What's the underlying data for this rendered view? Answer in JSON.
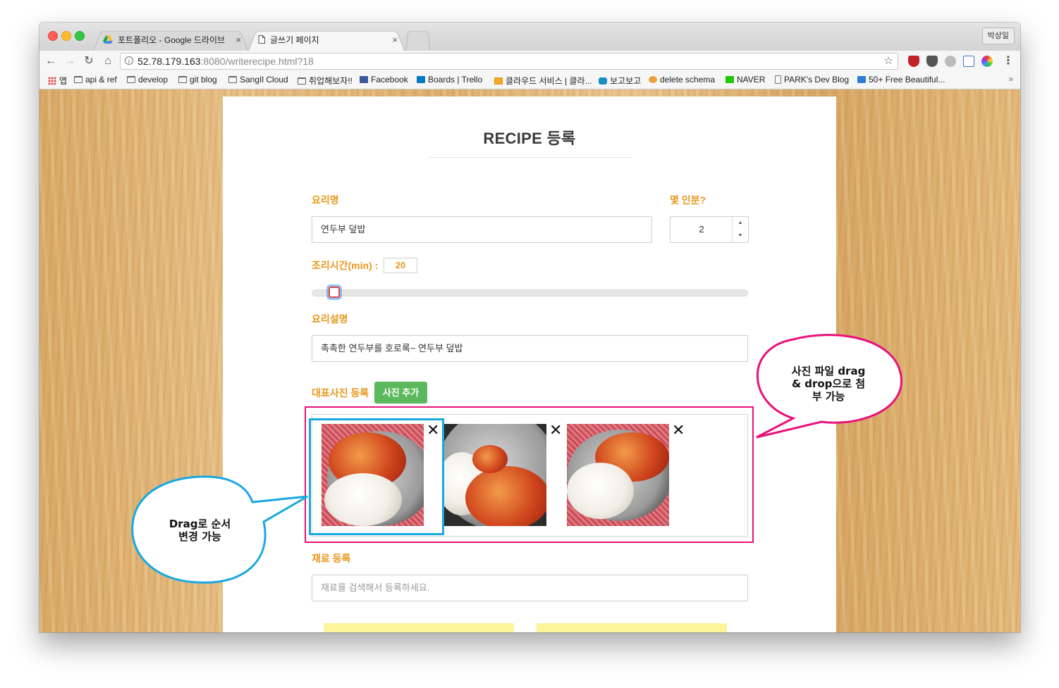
{
  "browser": {
    "tabs": [
      {
        "title": "포트폴리오 - Google 드라이브",
        "close": "×",
        "active": false
      },
      {
        "title": "글쓰기 페이지",
        "close": "×",
        "active": true
      }
    ],
    "profile_name": "박상일",
    "url_host": "52.78.179.163",
    "url_rest": ":8080/writerecipe.html?18",
    "bookmarks": [
      {
        "label": "앱",
        "icon": "apps-icon"
      },
      {
        "label": "api & ref",
        "icon": "folder-icon"
      },
      {
        "label": "develop",
        "icon": "folder-icon"
      },
      {
        "label": "git blog",
        "icon": "folder-icon"
      },
      {
        "label": "SangIl Cloud",
        "icon": "folder-icon"
      },
      {
        "label": "취업해보자!!",
        "icon": "folder-icon"
      },
      {
        "label": "Facebook",
        "icon": "facebook-icon"
      },
      {
        "label": "Boards | Trello",
        "icon": "trello-icon"
      },
      {
        "label": "클라우드 서비스 | 클라...",
        "icon": "cloud-icon"
      },
      {
        "label": "보고보고",
        "icon": "bogo-icon"
      },
      {
        "label": "delete schema",
        "icon": "schema-icon"
      },
      {
        "label": "NAVER",
        "icon": "naver-icon"
      },
      {
        "label": "PARK's Dev Blog",
        "icon": "page-icon"
      },
      {
        "label": "50+ Free Beautiful...",
        "icon": "free-icon"
      }
    ],
    "more": "»"
  },
  "form": {
    "title": "RECIPE 등록",
    "dish_name_label": "요리명",
    "dish_name_value": "연두부 덮밥",
    "servings_label": "몇 인분?",
    "servings_value": "2",
    "cook_time_label": "조리시간(min) :",
    "cook_time_value": "20",
    "cook_time_slider_fraction": 0.04,
    "description_label": "요리설명",
    "description_value": "촉촉한 연두부를 호로록~ 연두부 덮밥",
    "photo_label": "대표사진 등록",
    "photo_add_button": "사진 추가",
    "photos": [
      {
        "remove": "✕",
        "variant": "rice-with-sauce"
      },
      {
        "remove": "✕",
        "variant": "spoon-closeup"
      },
      {
        "remove": "✕",
        "variant": "rice-with-sauce"
      }
    ],
    "ingredient_label": "재료 등록",
    "ingredient_placeholder": "재료를 검색해서 등록하세요."
  },
  "callouts": {
    "drop": [
      "사진 파일 drag",
      "& drop으로 첨",
      "부 가능"
    ],
    "drag": [
      "Drag로 순서",
      "변경 가능"
    ],
    "colors": {
      "drop": "#e8127c",
      "drag": "#19a8e0"
    }
  }
}
